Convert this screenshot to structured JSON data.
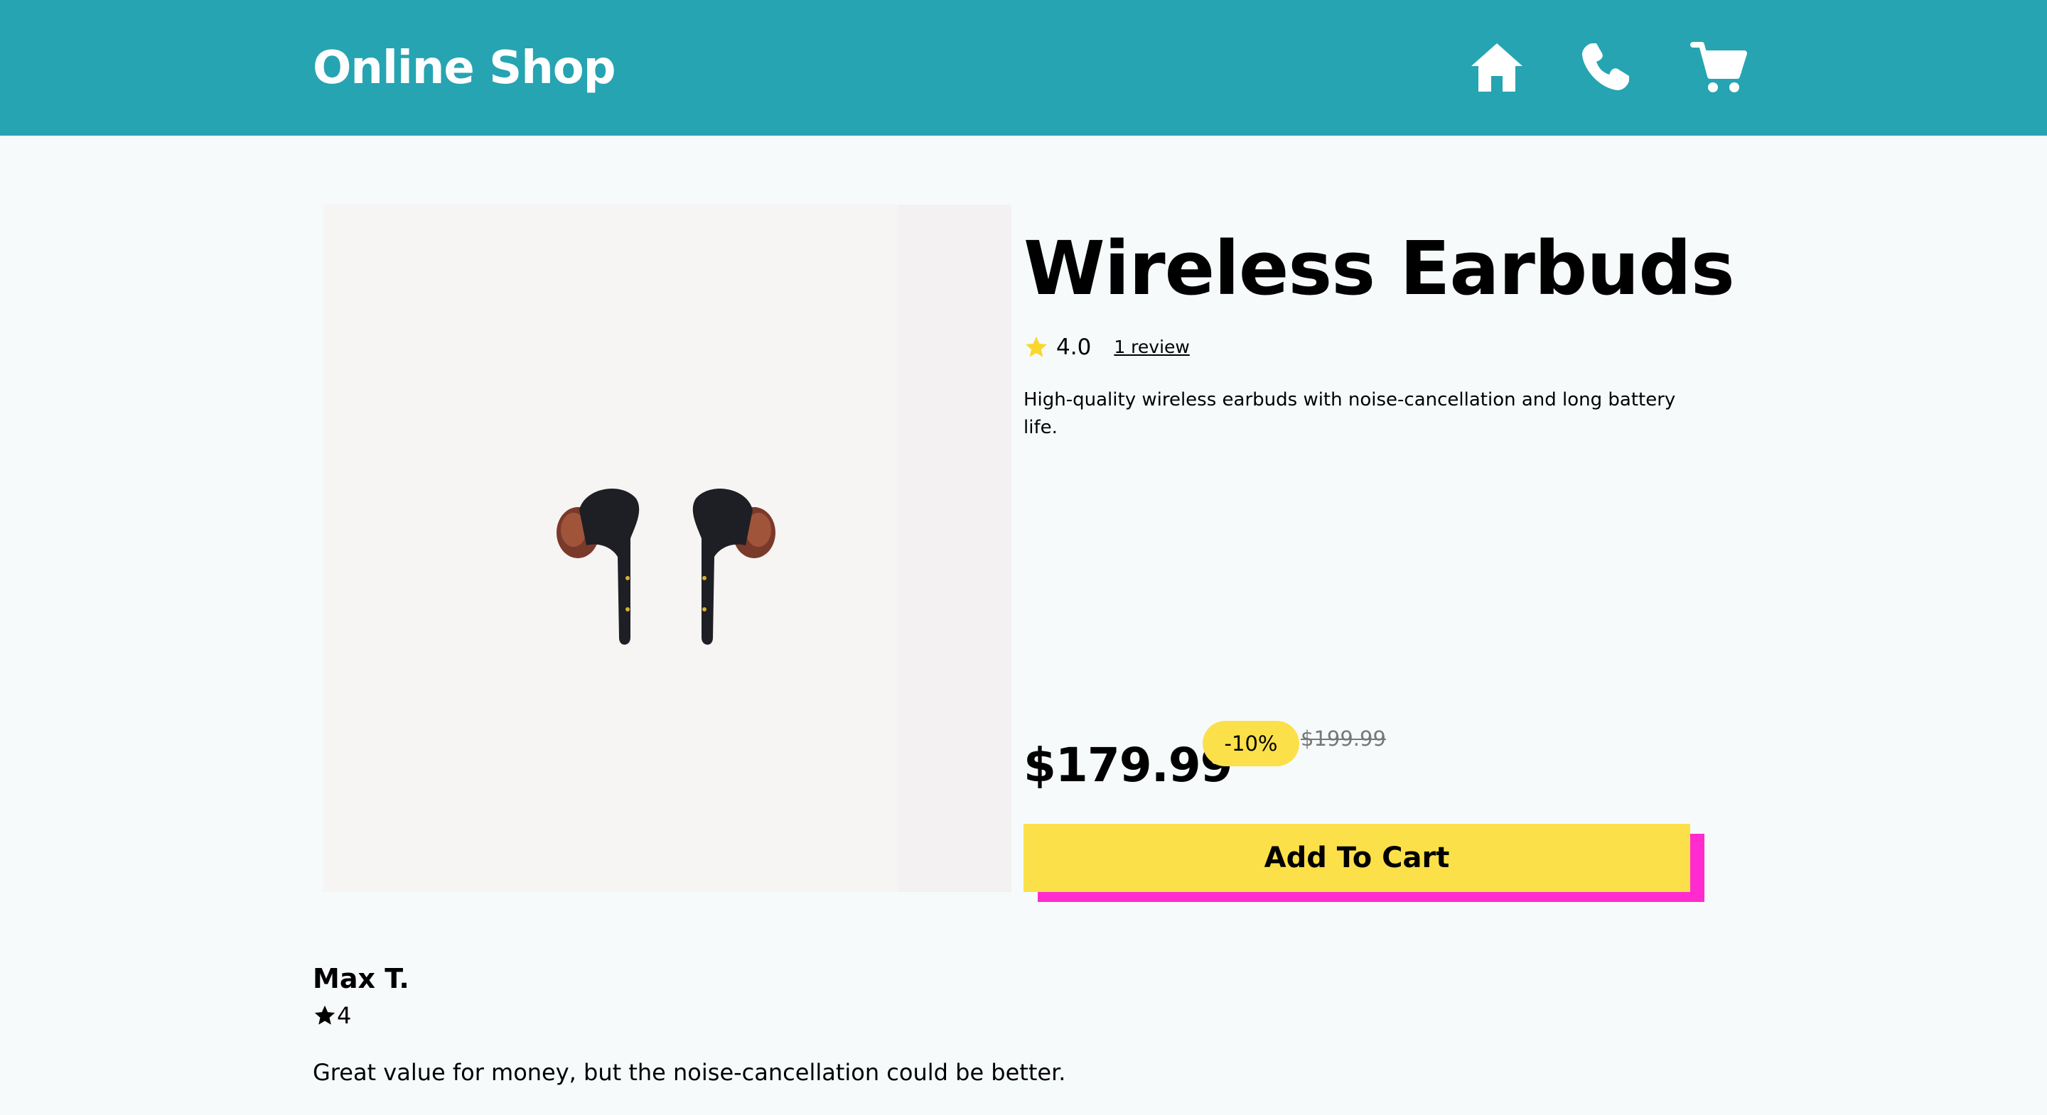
{
  "header": {
    "brand": "Online Shop",
    "nav_icons": [
      "home-icon",
      "phone-icon",
      "cart-icon"
    ],
    "background": "#26a4b1"
  },
  "product": {
    "title": "Wireless Earbuds",
    "rating": "4.0",
    "review_link": "1 review",
    "description": "High-quality wireless earbuds with noise-cancellation and long battery life.",
    "price": "$179.99",
    "discount": "-10%",
    "original_price": "$199.99",
    "add_to_cart_label": "Add To Cart"
  },
  "reviews": [
    {
      "author": "Max T.",
      "rating": "4",
      "text": "Great value for money, but the noise-cancellation could be better."
    }
  ],
  "colors": {
    "accent_yellow": "#fce049",
    "accent_pink": "#ff2bcf",
    "star_yellow": "#fbd72b",
    "page_background": "#f6fafb"
  }
}
